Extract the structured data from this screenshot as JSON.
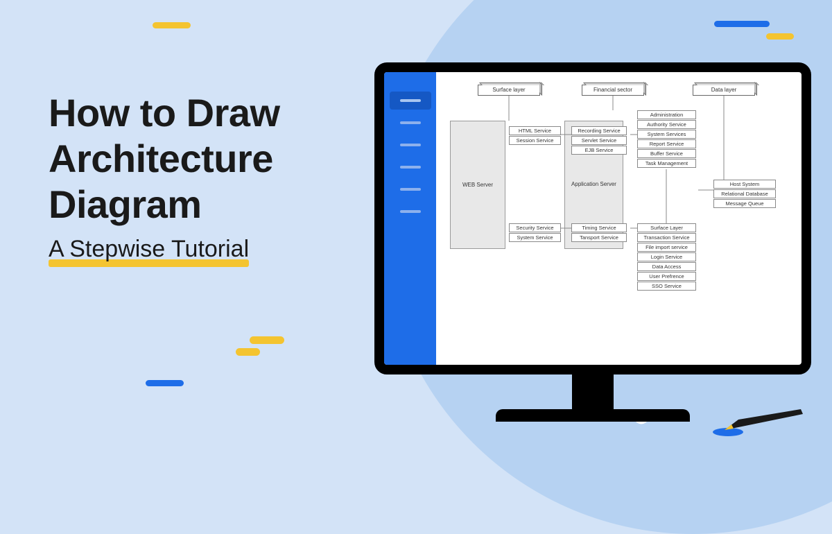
{
  "heading": {
    "title_line1": "How to Draw",
    "title_line2": "Architecture",
    "title_line3": "Diagram",
    "subtitle": "A Stepwise Tutorial"
  },
  "decorations": {
    "top_left_yellow": "#f4c430",
    "top_right_blue": "#1e6de8",
    "top_right_yellow": "#f4c430",
    "mid_yellow1": "#f4c430",
    "mid_yellow2": "#f4c430",
    "mid_blue": "#1e6de8"
  },
  "diagram": {
    "headers": [
      "Surface layer",
      "Financial sector",
      "Data layer"
    ],
    "web_server": "WEB Server",
    "app_server": "Application Server",
    "col1_top": [
      "HTML Service",
      "Session Service"
    ],
    "col1_bot": [
      "Security Service",
      "System Service"
    ],
    "col2_top": [
      "Recording Service",
      "Servlet Service",
      "EJB Service"
    ],
    "col2_bot": [
      "Timing Service",
      "Tansport Service"
    ],
    "col3_top": [
      "Administration",
      "Authority Service",
      "System Services",
      "Report Service",
      "Buffer Service",
      "Task Management"
    ],
    "col3_bot": [
      "Surface Layer",
      "Transaction Service",
      "File import service",
      "Login Service",
      "Data Access",
      "User Prefrence",
      "SSO Service"
    ],
    "col4": [
      "Host System",
      "Relational Database",
      "Message Queue"
    ]
  }
}
